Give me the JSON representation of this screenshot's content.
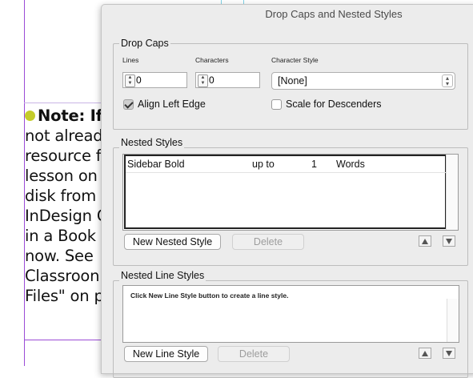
{
  "document": {
    "lines": [
      "Note: If",
      "not alread",
      "resource f",
      "lesson on",
      "disk from",
      "InDesign C",
      "in a Book",
      "now. See",
      "Classroon",
      "Files\" on p"
    ]
  },
  "dialog": {
    "title": "Drop Caps and Nested Styles",
    "drop_caps": {
      "group_label": "Drop Caps",
      "lines_label": "Lines",
      "lines_value": "0",
      "characters_label": "Characters",
      "characters_value": "0",
      "char_style_label": "Character Style",
      "char_style_value": "[None]",
      "align_left_edge_label": "Align Left Edge",
      "align_left_edge_checked": true,
      "scale_descenders_label": "Scale for Descenders",
      "scale_descenders_checked": false
    },
    "nested_styles": {
      "group_label": "Nested Styles",
      "rows": [
        {
          "style": "Sidebar Bold",
          "condition": "up to",
          "count": "1",
          "unit": "Words"
        }
      ],
      "new_button": "New Nested Style",
      "delete_button": "Delete"
    },
    "nested_line_styles": {
      "group_label": "Nested Line Styles",
      "hint": "Click New Line Style button to create a line style.",
      "new_button": "New Line Style",
      "delete_button": "Delete"
    }
  },
  "colors": {
    "bullet": "#c4cc2a",
    "margin_guide": "#9b4cd6"
  }
}
